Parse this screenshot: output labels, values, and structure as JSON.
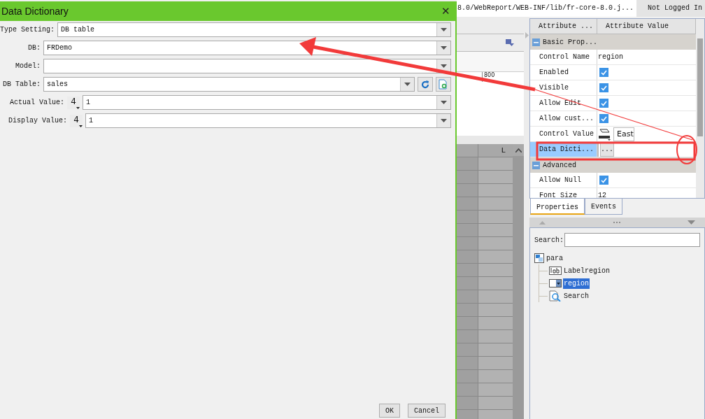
{
  "dialog": {
    "title": "Data Dictionary",
    "close": "✕",
    "fields": [
      {
        "kind": "select",
        "label": "Type Setting:",
        "value": "DB table"
      },
      {
        "kind": "select",
        "label": "DB:",
        "value": "FRDemo"
      },
      {
        "kind": "select",
        "label": "Model:"
      },
      {
        "kind": "table",
        "label": "DB Table:",
        "value": "sales"
      },
      {
        "kind": "typed",
        "label": "Actual Value:",
        "type": "4",
        "value": "1"
      },
      {
        "kind": "typed",
        "label": "Display Value:",
        "type": "4",
        "value": "1"
      }
    ],
    "buttons": [
      "OK",
      "Cancel"
    ]
  },
  "top_bar": {
    "path": "8.0/WebReport/WEB-INF/lib/fr-core-8.0.j...",
    "status": "Not Logged In"
  },
  "ruler": {
    "mark": "800"
  },
  "grid": {
    "column": "L"
  },
  "properties": {
    "columns": [
      "Attribute ...",
      "Attribute Value"
    ],
    "rows": [
      {
        "kind": "group",
        "label": "Basic Prop..."
      },
      {
        "kind": "text",
        "label": "Control Name",
        "value": "region",
        "selected": false
      },
      {
        "kind": "checkbox",
        "label": "Enabled",
        "checked": true,
        "selected": false
      },
      {
        "kind": "checkbox",
        "label": "Visible",
        "checked": true,
        "selected": false
      },
      {
        "kind": "checkbox",
        "label": "Allow Edit",
        "checked": true,
        "selected": false
      },
      {
        "kind": "checkbox",
        "label": "Allow cust...",
        "checked": true,
        "selected": false
      },
      {
        "kind": "control",
        "label": "Control Value",
        "value": "East",
        "selected": false
      },
      {
        "kind": "dict",
        "label": "Data Dicti...",
        "button": "...",
        "selected": true
      },
      {
        "kind": "group",
        "label": "Advanced"
      },
      {
        "kind": "checkbox",
        "label": "Allow Null",
        "checked": true,
        "selected": false
      },
      {
        "kind": "text",
        "label": "Font Size",
        "value": "12",
        "selected": false
      }
    ]
  },
  "tabs": [
    {
      "label": "Properties",
      "selected": true
    },
    {
      "label": "Events",
      "selected": false
    }
  ],
  "tree": {
    "search_label": "Search:",
    "items": [
      {
        "kind": "form",
        "label": "para",
        "selected": false,
        "children": [
          {
            "kind": "label",
            "label": "Labelregion",
            "selected": false
          },
          {
            "kind": "combo",
            "label": "region",
            "selected": true
          },
          {
            "kind": "search",
            "label": "Search",
            "selected": false
          }
        ]
      }
    ]
  }
}
